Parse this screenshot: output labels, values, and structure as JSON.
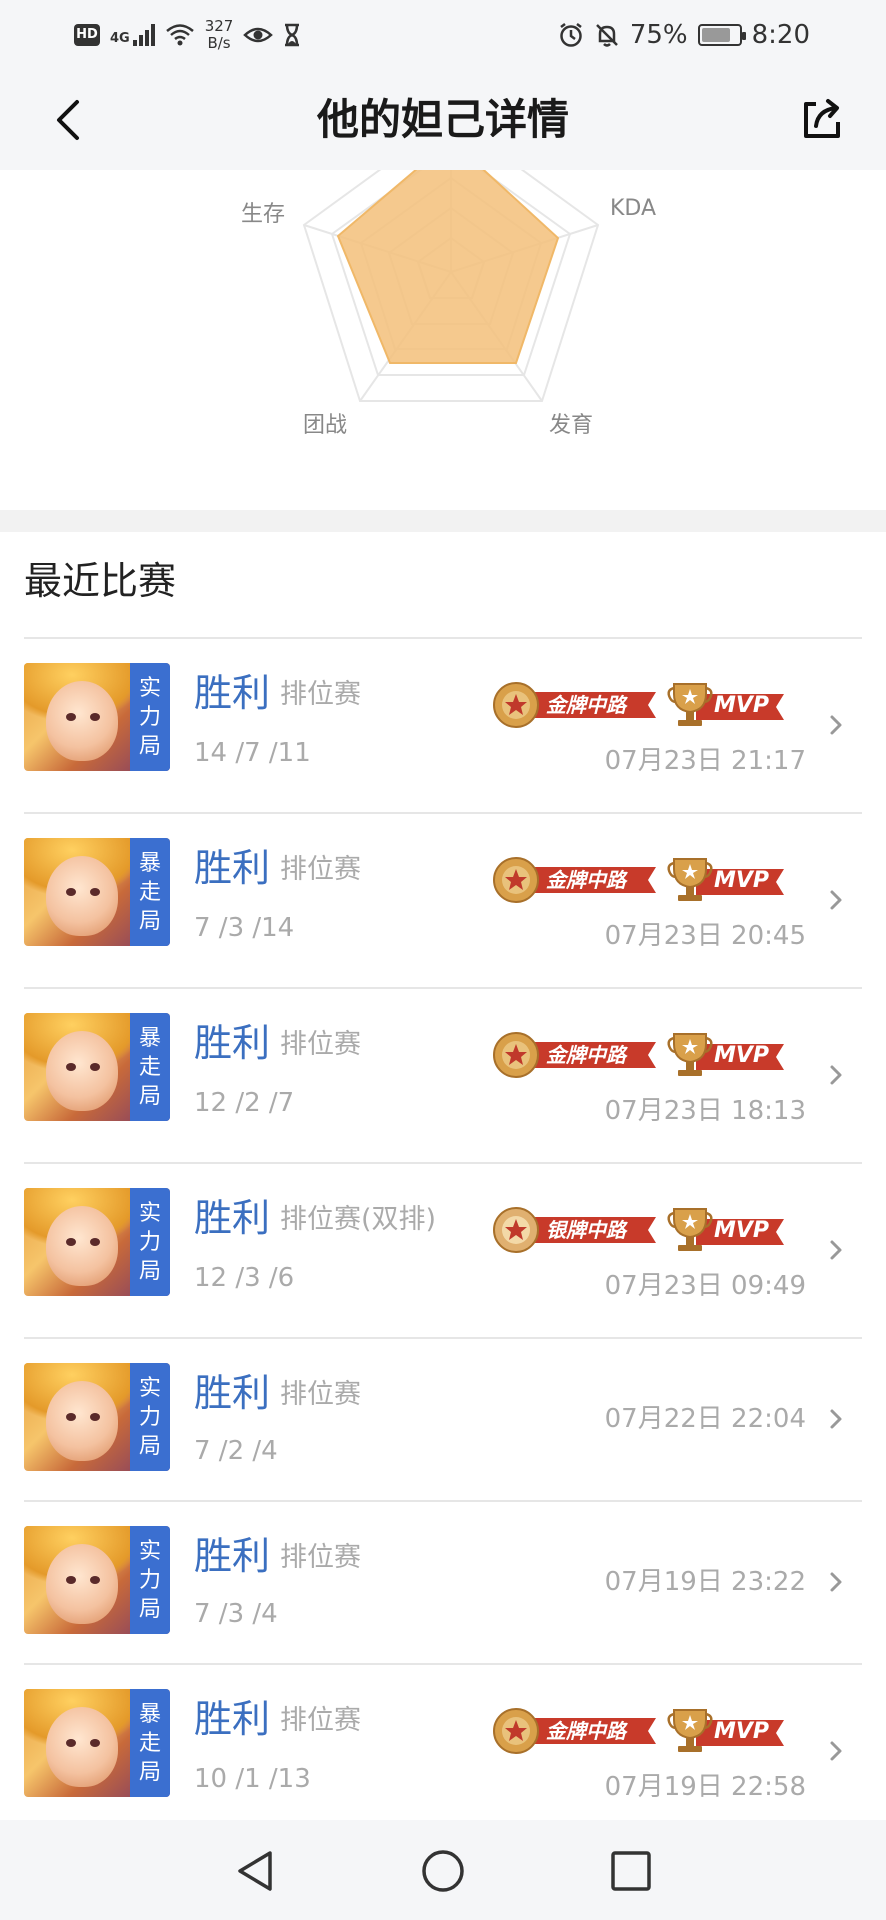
{
  "status_bar": {
    "hd": "HD",
    "network": "4G",
    "speed_value": "327",
    "speed_unit": "B/s",
    "battery": "75%",
    "time": "8:20"
  },
  "header": {
    "title": "他的妲己详情"
  },
  "radar": {
    "labels": {
      "survival": "生存",
      "kda": "KDA",
      "teamfight": "团战",
      "farming": "发育"
    }
  },
  "section": {
    "title": "最近比赛"
  },
  "matches": [
    {
      "tag": [
        "实",
        "力",
        "局"
      ],
      "result": "胜利",
      "mode": "排位赛",
      "kda": "14 /7 /11",
      "date": "07月23日 21:17",
      "medal": "金牌中路",
      "medal_type": "gold",
      "mvp": "MVP"
    },
    {
      "tag": [
        "暴",
        "走",
        "局"
      ],
      "result": "胜利",
      "mode": "排位赛",
      "kda": "7 /3 /14",
      "date": "07月23日 20:45",
      "medal": "金牌中路",
      "medal_type": "gold",
      "mvp": "MVP"
    },
    {
      "tag": [
        "暴",
        "走",
        "局"
      ],
      "result": "胜利",
      "mode": "排位赛",
      "kda": "12 /2 /7",
      "date": "07月23日 18:13",
      "medal": "金牌中路",
      "medal_type": "gold",
      "mvp": "MVP"
    },
    {
      "tag": [
        "实",
        "力",
        "局"
      ],
      "result": "胜利",
      "mode": "排位赛(双排)",
      "kda": "12 /3 /6",
      "date": "07月23日 09:49",
      "medal": "银牌中路",
      "medal_type": "silver",
      "mvp": "MVP"
    },
    {
      "tag": [
        "实",
        "力",
        "局"
      ],
      "result": "胜利",
      "mode": "排位赛",
      "kda": "7 /2 /4",
      "date": "07月22日 22:04",
      "medal": "",
      "medal_type": "",
      "mvp": ""
    },
    {
      "tag": [
        "实",
        "力",
        "局"
      ],
      "result": "胜利",
      "mode": "排位赛",
      "kda": "7 /3 /4",
      "date": "07月19日 23:22",
      "medal": "",
      "medal_type": "",
      "mvp": ""
    },
    {
      "tag": [
        "暴",
        "走",
        "局"
      ],
      "result": "胜利",
      "mode": "排位赛",
      "kda": "10 /1 /13",
      "date": "07月19日 22:58",
      "medal": "金牌中路",
      "medal_type": "gold",
      "mvp": "MVP"
    }
  ],
  "colors": {
    "accent_blue": "#3b6fc0",
    "tag_blue": "#3b6fd0",
    "radar_fill": "#f3c07a",
    "medal_red": "#c83a2a",
    "medal_gold": "#d9a04a"
  }
}
